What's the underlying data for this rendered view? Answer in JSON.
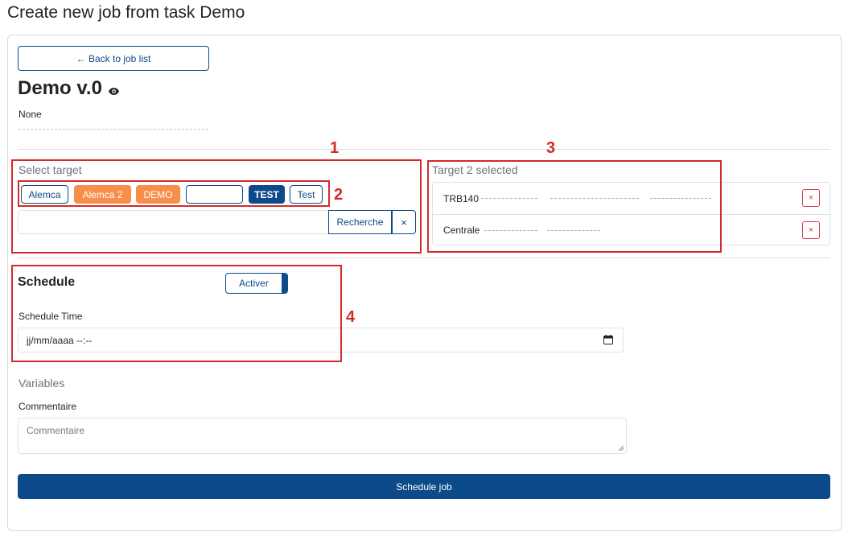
{
  "page_title": "Create new job from task Demo",
  "back_button": "← Back to job list",
  "task": {
    "name": "Demo v.0",
    "description": "None"
  },
  "select_target": {
    "label": "Select target",
    "targets": [
      "Alemca",
      "Alemca 2",
      "DEMO",
      "",
      "TEST",
      "Test"
    ],
    "search_button": "Recherche",
    "clear_button": "×"
  },
  "selected_targets": {
    "label": "Target 2 selected",
    "items": [
      {
        "name": "TRB140"
      },
      {
        "name": "Centrale"
      }
    ],
    "remove_icon": "×"
  },
  "schedule": {
    "title": "Schedule",
    "toggle_label": "Activer",
    "time_label": "Schedule Time",
    "time_value": "jj/mm/aaaa --:--"
  },
  "variables": {
    "title": "Variables",
    "comment_label": "Commentaire",
    "comment_placeholder": "Commentaire"
  },
  "schedule_job_button": "Schedule job",
  "annotations": [
    "1",
    "2",
    "3",
    "4"
  ],
  "colors": {
    "primary": "#0d4a8a",
    "orange": "#f78f4a",
    "danger": "#dc3545",
    "annotation": "#d42a2a"
  }
}
